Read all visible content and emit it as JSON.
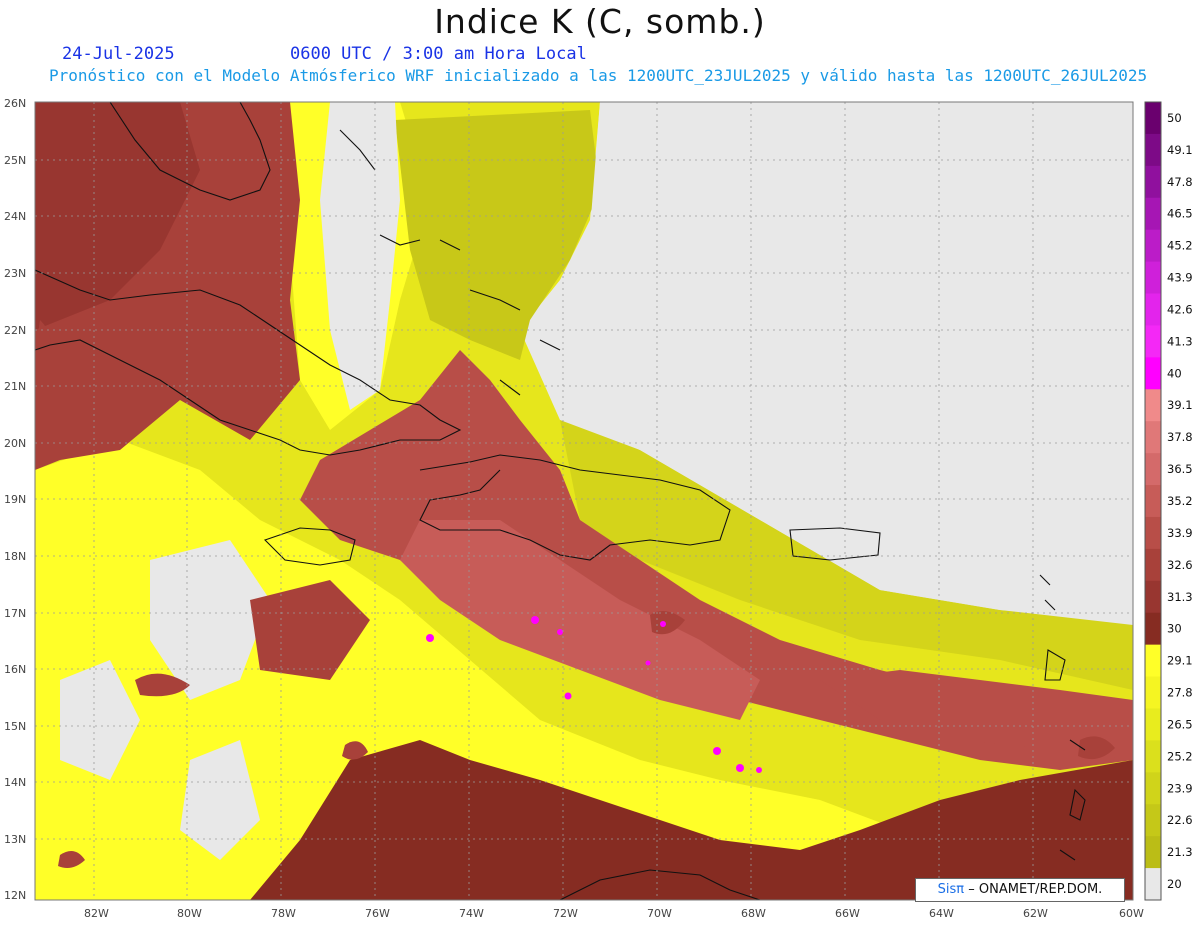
{
  "header": {
    "title": "Indice K (C, somb.)",
    "date": "24-Jul-2025",
    "valid_time": "0600 UTC / 3:00 am Hora Local",
    "forecast_note": "Pronóstico con el Modelo Atmósferico WRF inicializado a las 1200UTC_23JUL2025 y válido hasta las  1200UTC_26JUL2025"
  },
  "map": {
    "lat_labels": [
      "26N",
      "25N",
      "24N",
      "23N",
      "22N",
      "21N",
      "20N",
      "19N",
      "18N",
      "17N",
      "16N",
      "15N",
      "14N",
      "13N",
      "12N"
    ],
    "lon_labels": [
      "82W",
      "80W",
      "78W",
      "76W",
      "74W",
      "72W",
      "70W",
      "68W",
      "66W",
      "64W",
      "62W",
      "60W"
    ],
    "background_color": "#e8e8e8"
  },
  "colorbar": {
    "labels": [
      "50",
      "49.1",
      "47.8",
      "46.5",
      "45.2",
      "43.9",
      "42.6",
      "41.3",
      "40",
      "39.1",
      "37.8",
      "36.5",
      "35.2",
      "33.9",
      "32.6",
      "31.3",
      "30",
      "29.1",
      "27.8",
      "26.5",
      "25.2",
      "23.9",
      "22.6",
      "21.3",
      "20"
    ],
    "colors": [
      "#6a006e",
      "#7d0a87",
      "#90109e",
      "#a616b4",
      "#bb1cc8",
      "#cf20da",
      "#e324ec",
      "#f428f6",
      "#ff00ff",
      "#f08a8a",
      "#e07878",
      "#d46a6a",
      "#c75c58",
      "#b84e48",
      "#a8413a",
      "#983630",
      "#862c22",
      "#ffff28",
      "#f5f522",
      "#e8ec1e",
      "#dbe01c",
      "#d0d41a",
      "#c5c818",
      "#bbbd16",
      "#e8e8e8"
    ]
  },
  "credit": {
    "brand": "Sisπ",
    "text": "– ONAMET/REP.DOM."
  }
}
